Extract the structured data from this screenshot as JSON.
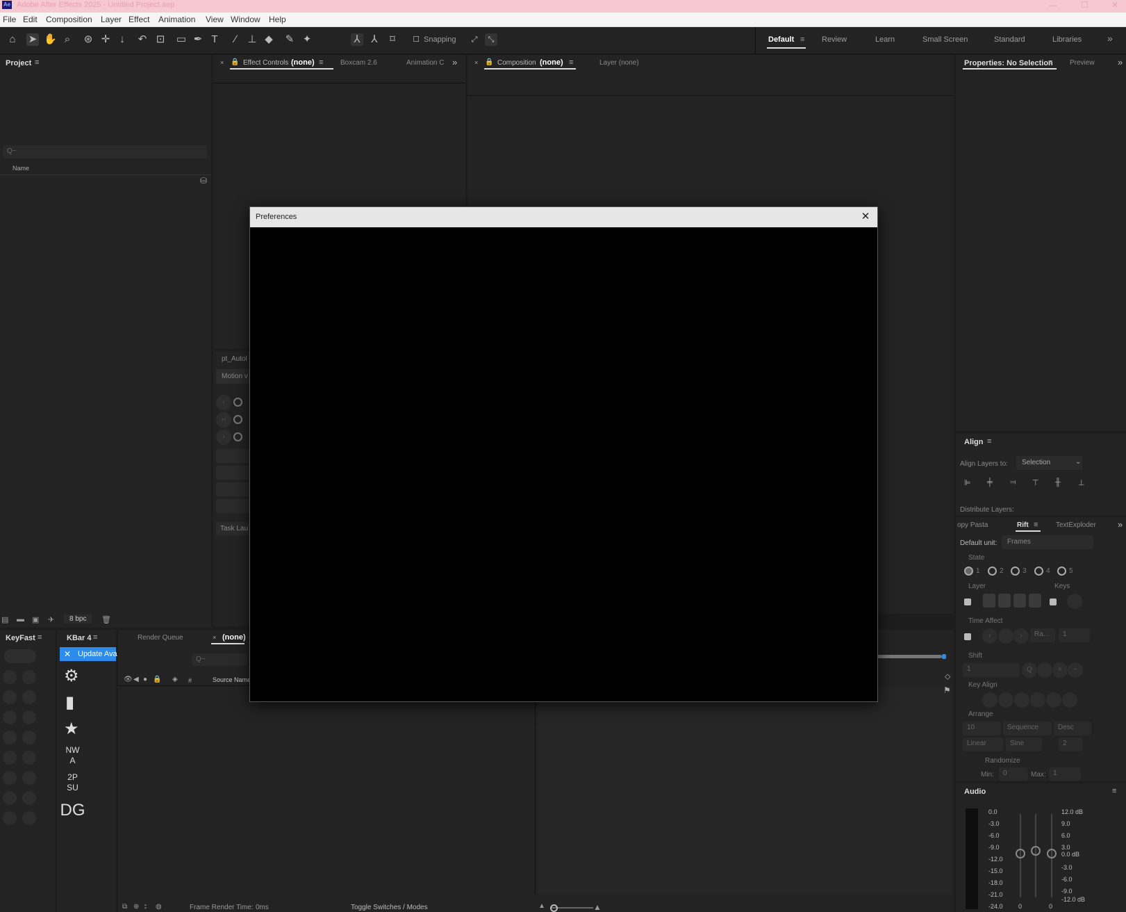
{
  "app": {
    "title": "Adobe After Effects 2025 - Untitled Project.aep",
    "icon_text": "Ae"
  },
  "window_controls": {
    "minimize": "—",
    "maximize": "☐",
    "close": "✕"
  },
  "menu": [
    "File",
    "Edit",
    "Composition",
    "Layer",
    "Effect",
    "Animation",
    "View",
    "Window",
    "Help"
  ],
  "toolbar": {
    "snapping_label": "Snapping",
    "workspaces": [
      "Default",
      "Review",
      "Learn",
      "Small Screen",
      "Standard",
      "Libraries"
    ],
    "more": "»"
  },
  "project_panel": {
    "title": "Project",
    "name_col": "Name",
    "bpc": "8 bpc",
    "search_placeholder": "Q~"
  },
  "effect_panel": {
    "tab1_label": "Effect Controls",
    "tab1_value": "(none)",
    "tab2": "Boxcam 2.6",
    "tab3": "Animation C",
    "more": "»"
  },
  "comp_panel": {
    "tab1_label": "Composition",
    "tab1_value": "(none)",
    "tab2": "Layer (none)"
  },
  "autofill_panel": {
    "title": "pt_Autol",
    "button": "Motion v",
    "task": "Task Lau"
  },
  "properties_panel": {
    "title": "Properties: No Selection",
    "tab2": "Preview"
  },
  "align_panel": {
    "title": "Align",
    "align_to_label": "Align Layers to:",
    "align_to_value": "Selection",
    "distribute_label": "Distribute Layers:"
  },
  "rift_panel": {
    "tabs": [
      "opy Pasta",
      "Rift",
      "TextExploder"
    ],
    "default_unit_label": "Default unit:",
    "default_unit_value": "Frames",
    "state_label": "State",
    "states": [
      "1",
      "2",
      "3",
      "4",
      "5"
    ],
    "layer_label": "Layer",
    "keys_label": "Keys",
    "time_affect_label": "Time Affect",
    "time_affect_value": "Ra...",
    "time_affect_num": "1",
    "shift_label": "Shift",
    "shift_value": "1",
    "key_align_label": "Key Align",
    "arrange_label": "Arrange",
    "arrange_value": "10",
    "arrange_mode": "Sequence",
    "arrange_order": "Desc",
    "ease1": "Linear",
    "ease2": "Sine",
    "ease_num": "2",
    "randomize_label": "Randomize",
    "min_label": "Min:",
    "min_value": "0",
    "max_label": "Max:",
    "max_value": "1"
  },
  "audio_panel": {
    "title": "Audio",
    "left_scale": [
      "0.0",
      "-3.0",
      "-6.0",
      "-9.0",
      "-12.0",
      "-15.0",
      "-18.0",
      "-21.0",
      "-24.0"
    ],
    "right_scale": [
      "12.0 dB",
      "9.0",
      "6.0",
      "3.0",
      "0.0 dB",
      "-3.0",
      "-6.0",
      "-9.0",
      "-12.0 dB"
    ],
    "bottom": [
      "0",
      "0"
    ]
  },
  "keyfast_panel": {
    "title": "KeyFast"
  },
  "kbar_panel": {
    "title": "KBar 4",
    "update_label": "Update Ava",
    "texts": [
      "NW\nA",
      "2P\nSU",
      "DG"
    ]
  },
  "timeline": {
    "tab1": "Render Queue",
    "tab2": "(none)",
    "source_col": "Source Name",
    "hash": "#",
    "frame_render_label": "Frame Render Time:",
    "frame_render_value": "0ms",
    "toggle_label": "Toggle Switches / Modes"
  },
  "dialog": {
    "title": "Preferences",
    "close": "✕"
  },
  "colors": {
    "accent_blue": "#2d8ceb",
    "titlebar": "#f6c9d0",
    "panel_bg": "#232323"
  }
}
